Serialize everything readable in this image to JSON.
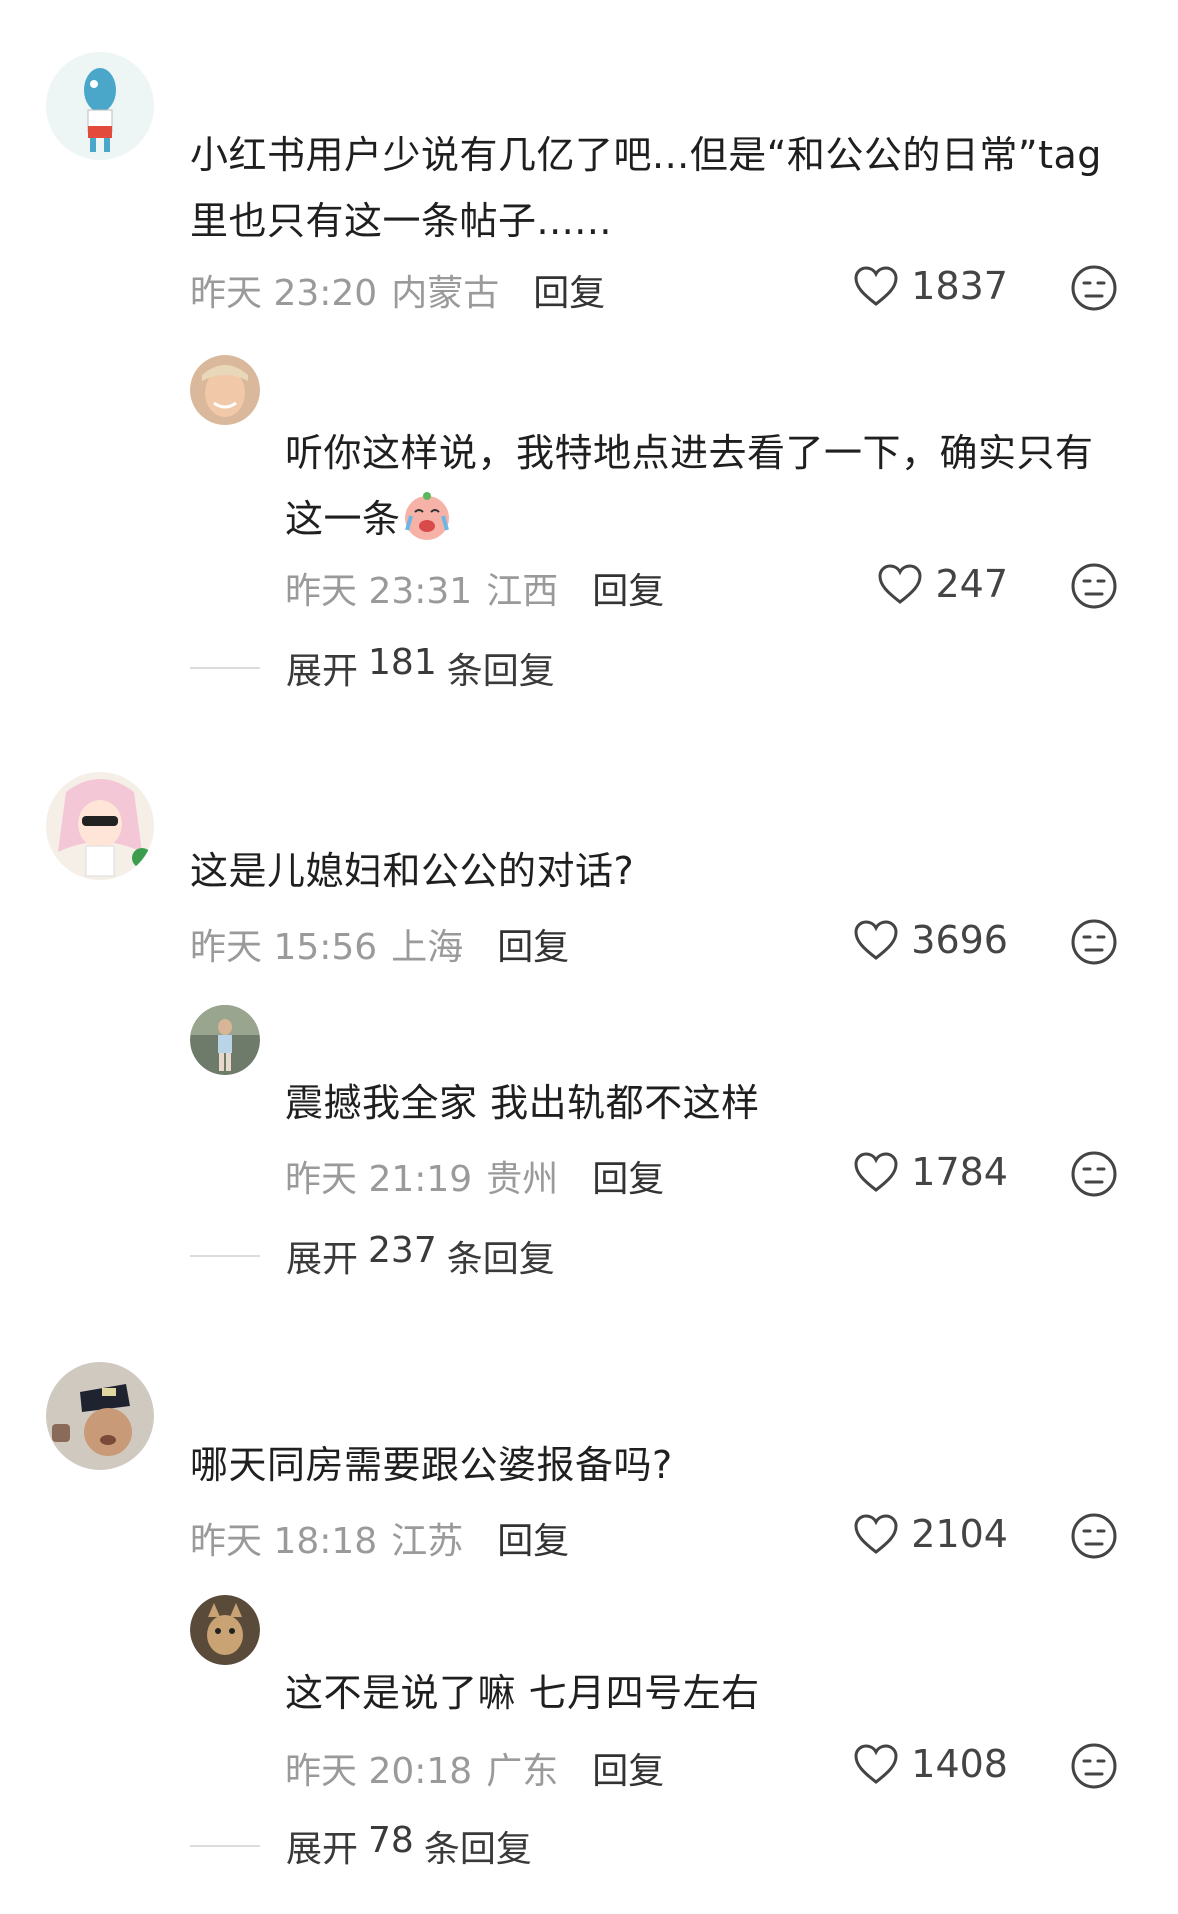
{
  "threads": [
    {
      "comment": {
        "text": "小红书用户少说有几亿了吧...但是“和公公的日常”tag里也只有这一条帖子......",
        "time": "昨天 23:20",
        "location": "内蒙古",
        "reply_label": "回复",
        "likes": "1837"
      },
      "reply": {
        "text": "听你这样说，我特地点进去看了一下，确实只有这一条",
        "emoji": "crying-laughing-emoji",
        "time": "昨天 23:31",
        "location": "江西",
        "reply_label": "回复",
        "likes": "247"
      },
      "expand": {
        "prefix": "展开",
        "count": "181",
        "suffix": "条回复"
      }
    },
    {
      "comment": {
        "text": "这是儿媳妇和公公的对话?",
        "time": "昨天 15:56",
        "location": "上海",
        "reply_label": "回复",
        "likes": "3696"
      },
      "reply": {
        "text": "震撼我全家 我出轨都不这样",
        "time": "昨天 21:19",
        "location": "贵州",
        "reply_label": "回复",
        "likes": "1784"
      },
      "expand": {
        "prefix": "展开",
        "count": "237",
        "suffix": "条回复"
      }
    },
    {
      "comment": {
        "text": "哪天同房需要跟公婆报备吗?",
        "time": "昨天 18:18",
        "location": "江苏",
        "reply_label": "回复",
        "likes": "2104"
      },
      "reply": {
        "text": "这不是说了嘛 七月四号左右",
        "time": "昨天 20:18",
        "location": "广东",
        "reply_label": "回复",
        "likes": "1408"
      },
      "expand": {
        "prefix": "展开",
        "count": "78",
        "suffix": "条回复"
      }
    }
  ],
  "icons": {
    "like": "heart-outline-icon",
    "dislike": "unamused-face-icon"
  },
  "colors": {
    "meta_text": "#9a9a9a",
    "body_text": "#1f1f1f",
    "icon_stroke": "#444444"
  }
}
